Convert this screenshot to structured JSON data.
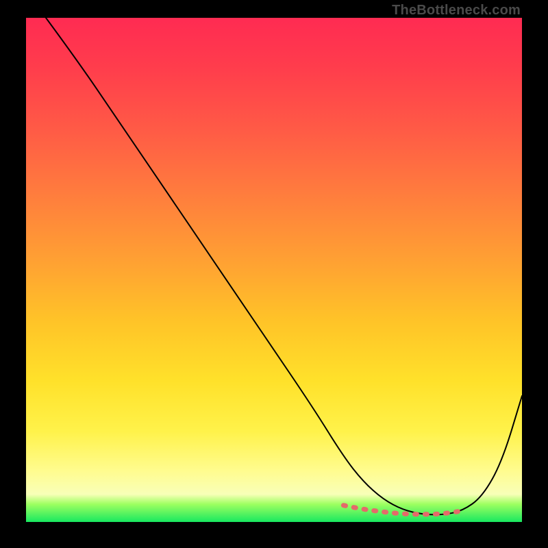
{
  "watermark": "TheBottleneck.com",
  "chart_data": {
    "type": "line",
    "title": "",
    "xlabel": "",
    "ylabel": "",
    "xlim": [
      0,
      100
    ],
    "ylim": [
      0,
      100
    ],
    "series": [
      {
        "name": "curve",
        "x": [
          4,
          10,
          18,
          28,
          38,
          48,
          58,
          64,
          68,
          72,
          76,
          80,
          84,
          88,
          92,
          96,
          100
        ],
        "y": [
          100,
          92,
          80.5,
          66,
          51.5,
          37,
          22.5,
          13,
          8,
          4.5,
          2.4,
          1.5,
          1.4,
          2.2,
          5,
          12,
          25
        ]
      },
      {
        "name": "highlight-dashes",
        "x": [
          64,
          68,
          72,
          76,
          80,
          84,
          88
        ],
        "y": [
          3.3,
          2.5,
          2.0,
          1.6,
          1.5,
          1.6,
          2.2
        ]
      }
    ],
    "colors": {
      "curve": "#000000",
      "highlight": "#e46a6a",
      "gradient_top": "#ff2b52",
      "gradient_bottom": "#18e860"
    }
  }
}
